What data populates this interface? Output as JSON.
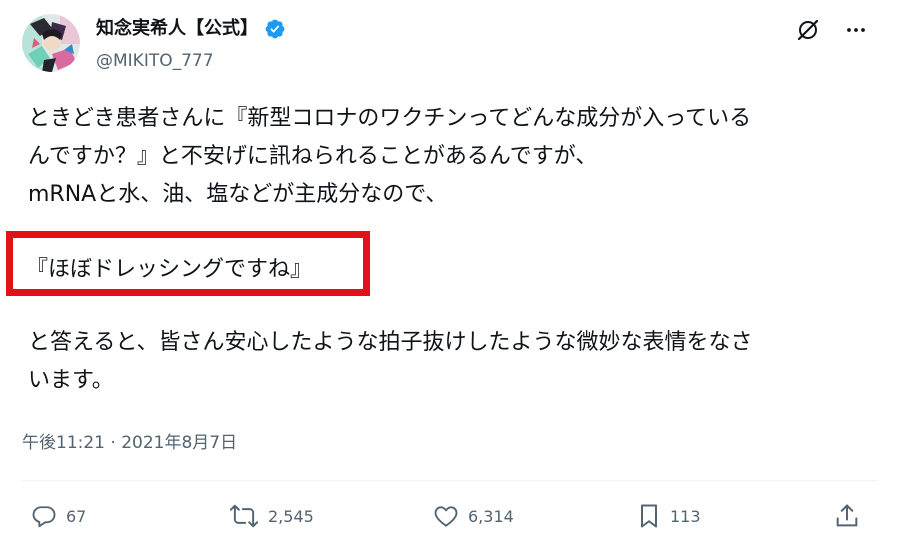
{
  "user": {
    "display_name": "知念実希人【公式】",
    "handle": "@MIKITO_777",
    "verified": true
  },
  "tweet": {
    "line1": "ときどき患者さんに『新型コロナのワクチンってどんな成分が入っている",
    "line2": "んですか？』と不安げに訊ねられることがあるんですが、",
    "line3": "mRNAと水、油、塩などが主成分なので、",
    "highlight": "『ほぼドレッシングですね』",
    "line5": "と答えると、皆さん安心したような拍子抜けしたような微妙な表情をなさ",
    "line6": "います。",
    "timestamp": "午後11:21 · 2021年8月7日"
  },
  "actions": {
    "reply_count": "67",
    "retweet_count": "2,545",
    "like_count": "6,314",
    "bookmark_count": "113"
  },
  "colors": {
    "text": "#0f1419",
    "muted": "#536471",
    "verified": "#1d9bf0",
    "highlight_border": "#e3111a"
  },
  "icons": {
    "verified": "verified-badge-icon",
    "grok": "grok-icon",
    "more": "more-options-icon",
    "reply": "reply-icon",
    "retweet": "retweet-icon",
    "like": "heart-icon",
    "bookmark": "bookmark-icon",
    "share": "share-icon"
  }
}
